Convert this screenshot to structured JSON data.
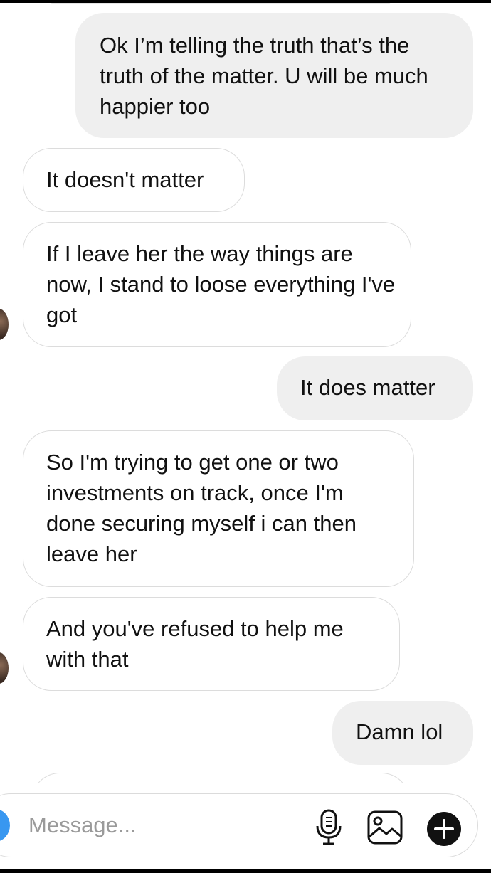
{
  "messages": [
    {
      "side": "out",
      "text": "Ok I’m telling the truth that’s the truth of the matter. U will be much happier too"
    },
    {
      "side": "in",
      "text": "It doesn't matter"
    },
    {
      "side": "in",
      "text": "If I leave her the way things are now, I stand to loose everything I've got"
    },
    {
      "side": "out",
      "text": "It does matter"
    },
    {
      "side": "in",
      "text": "So I'm trying to get one or two investments on track,  once I'm done securing myself i can then leave her"
    },
    {
      "side": "in",
      "text": "And you've refused to help me with that"
    },
    {
      "side": "out",
      "text": "Damn lol"
    }
  ],
  "composer": {
    "placeholder": "Message...",
    "icons": [
      "camera-icon",
      "microphone-icon",
      "gallery-icon",
      "plus-icon"
    ]
  },
  "colors": {
    "outgoing_bubble": "#efefef",
    "incoming_border": "#dcdcdc",
    "camera_button": "#3897f0"
  }
}
